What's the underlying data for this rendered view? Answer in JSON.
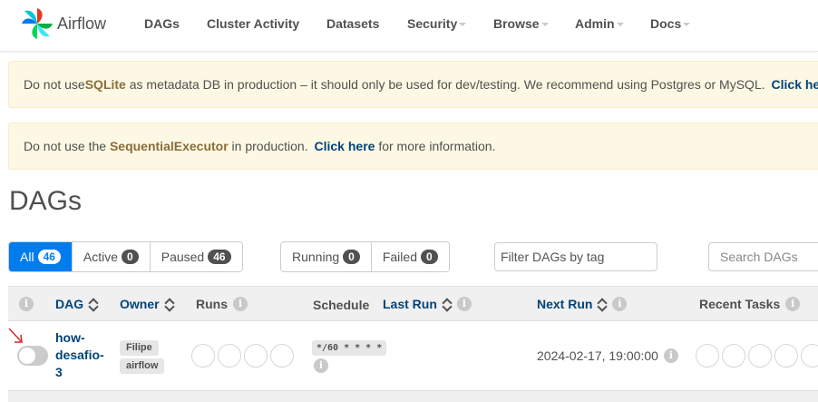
{
  "nav": {
    "brand": "Airflow",
    "items": [
      "DAGs",
      "Cluster Activity",
      "Datasets",
      "Security",
      "Browse",
      "Admin",
      "Docs"
    ]
  },
  "alerts": {
    "sqlite": {
      "pre": "Do not use ",
      "strong": "SQLite",
      "mid": " as metadata DB in production – it should only be used for dev/testing. We recommend using Postgres or MySQL. ",
      "link": "Click here"
    },
    "executor": {
      "pre": "Do not use the ",
      "strong": "SequentialExecutor",
      "mid": " in production. ",
      "link": "Click here",
      "post": " for more information."
    }
  },
  "page_title": "DAGs",
  "filters": {
    "all_label": "All",
    "all_count": "46",
    "active_label": "Active",
    "active_count": "0",
    "paused_label": "Paused",
    "paused_count": "46",
    "running_label": "Running",
    "running_count": "0",
    "failed_label": "Failed",
    "failed_count": "0",
    "tag_placeholder": "Filter DAGs by tag",
    "search_placeholder": "Search DAGs"
  },
  "table": {
    "headers": {
      "dag": "DAG",
      "owner": "Owner",
      "runs": "Runs",
      "schedule": "Schedule",
      "last_run": "Last Run",
      "next_run": "Next Run",
      "recent_tasks": "Recent Tasks"
    },
    "row": {
      "dag_id_lines": [
        "how-",
        "desafio-",
        "3"
      ],
      "owners": [
        "Filipe",
        "airflow"
      ],
      "schedule": "*/60 * * * *",
      "next_run": "2024-02-17, 19:00:00",
      "paused": true
    }
  },
  "colors": {
    "primary": "#017cee",
    "link": "#00437a",
    "warning_bg": "#fcf8e3",
    "annotation": "#d62728"
  },
  "icons": {
    "info": "info-icon",
    "sort": "sort-icon",
    "caret": "caret-down-icon",
    "logo": "airflow-pinwheel-icon"
  }
}
